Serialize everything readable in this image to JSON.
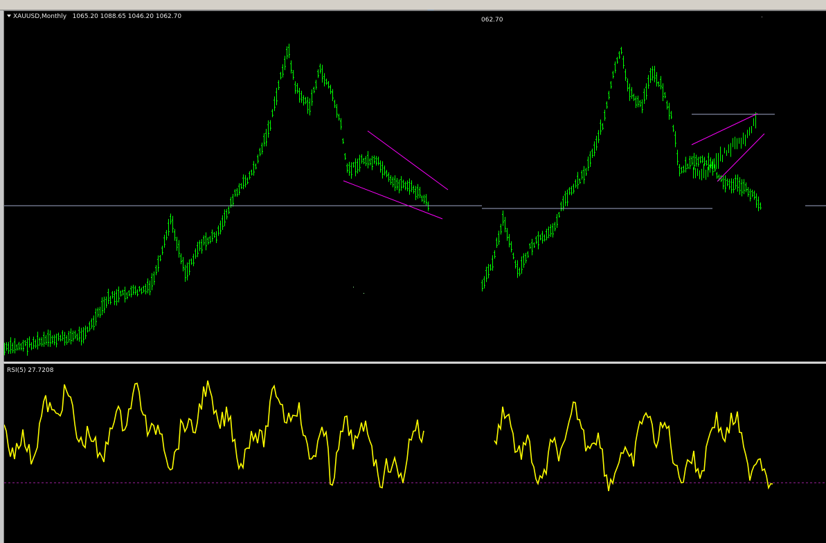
{
  "chart": {
    "symbol_label": "XAUUSD,Monthly",
    "ohlc_label": "1065.20 1088.65 1046.20 1062.70",
    "duplicate_label": "062.70",
    "bar_color": "#00ff00",
    "trendline_color": "#ff00ff",
    "hline_color": "#a0a8c8"
  },
  "indicator": {
    "label": "RSI(5) 27.7208",
    "line_color": "#ffff00",
    "level_color": "#a020a0"
  },
  "icons": {
    "collapse": "triangle-down-icon"
  }
}
